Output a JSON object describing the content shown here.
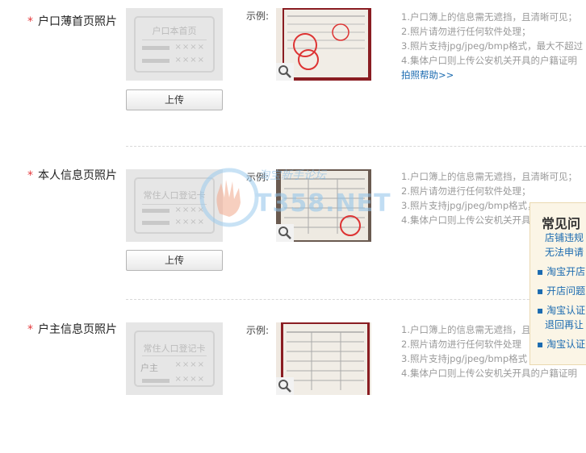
{
  "sections": [
    {
      "required_mark": "*",
      "label": "户口薄首页照片",
      "placeholder_title": "户口本首页",
      "placeholder_extra": "",
      "placeholder_x": "××××",
      "upload_label": "上传",
      "example_label": "示例:",
      "notes": [
        "1.户口簿上的信息需无遮挡，且清晰可见；",
        "2.照片请勿进行任何软件处理；",
        "3.照片支持jpg/jpeg/bmp格式，最大不超过",
        "4.集体户口则上传公安机关开具的户籍证明"
      ],
      "help_link": "拍照帮助>>"
    },
    {
      "required_mark": "*",
      "label": "本人信息页照片",
      "placeholder_title": "常住人口登记卡",
      "placeholder_extra": "",
      "placeholder_x": "××××",
      "upload_label": "上传",
      "example_label": "示例:",
      "notes": [
        "1.户口簿上的信息需无遮挡，且清晰可见；",
        "2.照片请勿进行任何软件处理；",
        "3.照片支持jpg/jpeg/bmp格式，",
        "4.集体户口则上传公安机关开具"
      ],
      "help_link": ""
    },
    {
      "required_mark": "*",
      "label": "户主信息页照片",
      "placeholder_title": "常住人口登记卡",
      "placeholder_extra": "户主",
      "placeholder_x": "××××",
      "upload_label": "",
      "example_label": "示例:",
      "notes": [
        "1.户口簿上的信息需无遮挡，且",
        "2.照片请勿进行任何软件处理",
        "3.照片支持jpg/jpeg/bmp格式",
        "4.集体户口则上传公安机关开具的户籍证明"
      ],
      "help_link": ""
    }
  ],
  "watermark": {
    "text": "T358.NET",
    "sub": "淘宝新手论坛"
  },
  "faq": {
    "title": "常见问",
    "items": [
      {
        "text": "店铺违规",
        "sub": "无法申请"
      },
      {
        "text": "淘宝开店",
        "sub": ""
      },
      {
        "text": "开店问题",
        "sub": ""
      },
      {
        "text": "淘宝认证",
        "sub": "退回再让"
      },
      {
        "text": "淘宝认证",
        "sub": ""
      }
    ]
  },
  "colors": {
    "required": "#e4393c",
    "link": "#1a6ab0",
    "note_text": "#9a9a9a"
  }
}
